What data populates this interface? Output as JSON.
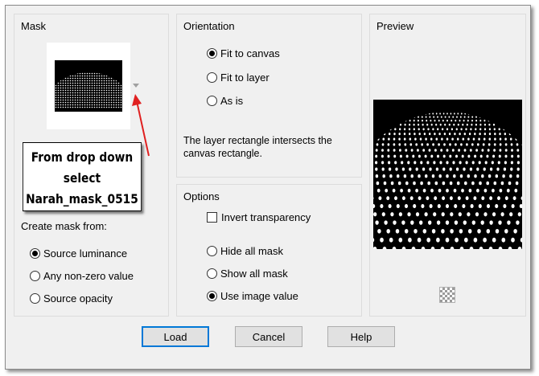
{
  "mask": {
    "title": "Mask",
    "create_title": "Create mask from:",
    "options": [
      {
        "label": "Source luminance",
        "checked": true
      },
      {
        "label": "Any non-zero value",
        "checked": false
      },
      {
        "label": "Source opacity",
        "checked": false
      }
    ]
  },
  "orientation": {
    "title": "Orientation",
    "options": [
      {
        "label": "Fit to canvas",
        "checked": true
      },
      {
        "label": "Fit to layer",
        "checked": false
      },
      {
        "label": "As is",
        "checked": false
      }
    ],
    "info": "The layer rectangle intersects the canvas rectangle."
  },
  "options_group": {
    "title": "Options",
    "invert_label": "Invert transparency",
    "invert_checked": false,
    "visibility": [
      {
        "label": "Hide all mask",
        "checked": false
      },
      {
        "label": "Show all mask",
        "checked": false
      },
      {
        "label": "Use image value",
        "checked": true
      }
    ]
  },
  "preview": {
    "title": "Preview"
  },
  "buttons": {
    "load": "Load",
    "cancel": "Cancel",
    "help": "Help"
  },
  "annotation": {
    "lines": [
      "From drop down",
      "select",
      "Narah_mask_0515"
    ],
    "arrow_color": "#e02020"
  },
  "colors": {
    "focus_border": "#0078d7"
  }
}
